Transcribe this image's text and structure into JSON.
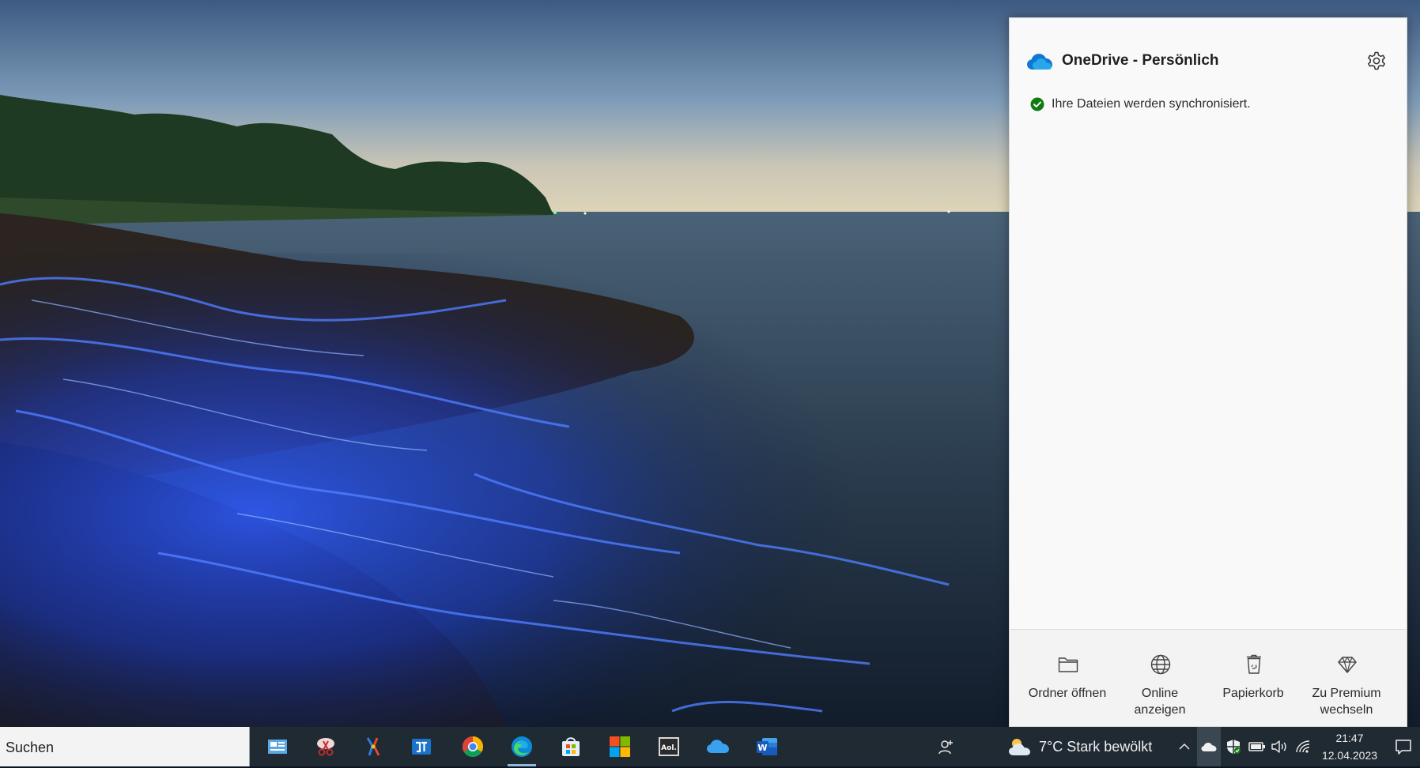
{
  "onedrive": {
    "title": "OneDrive - Persönlich",
    "status": "Ihre Dateien werden synchronisiert.",
    "actions": [
      {
        "label": "Ordner öffnen",
        "icon": "folder-icon"
      },
      {
        "label": "Online anzeigen",
        "icon": "globe-icon"
      },
      {
        "label": "Papierkorb",
        "icon": "recycle-bin-icon"
      },
      {
        "label": "Zu Premium wechseln",
        "icon": "diamond-icon"
      }
    ],
    "labels_split": {
      "ordner": "Ordner öffnen",
      "online_1": "Online",
      "online_2": "anzeigen",
      "papierkorb": "Papierkorb",
      "premium_1": "Zu Premium",
      "premium_2": "wechseln"
    }
  },
  "taskbar": {
    "search_placeholder": "Suchen",
    "apps": [
      "news-app-icon",
      "snipping-tool-icon",
      "paint-app-icon",
      "outlook-like-app-icon",
      "chrome-icon",
      "edge-icon",
      "store-icon",
      "microsoft-icon",
      "aol-icon",
      "onedrive-icon",
      "word-icon"
    ],
    "weather": "7°C  Stark bewölkt",
    "time": "21:47",
    "date": "12.04.2023"
  },
  "colors": {
    "flyout_bg": "#f9f9f9",
    "taskbar_bg": "#202a33",
    "onedrive_blue": "#0f6cbd",
    "success_green": "#107c10"
  }
}
